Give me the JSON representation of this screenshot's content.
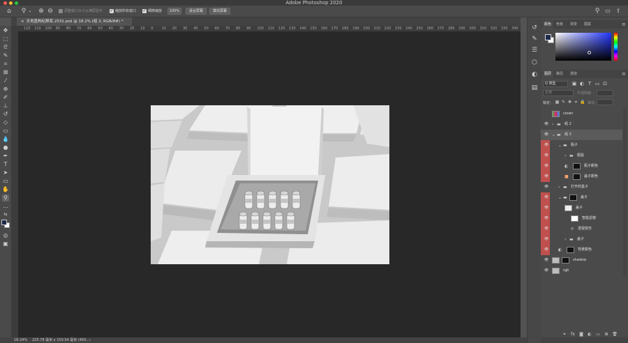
{
  "app": {
    "title": "Adobe Photoshop 2020",
    "traffic_colors": [
      "#ff5f57",
      "#febc2e",
      "#28c840"
    ]
  },
  "options_bar": {
    "resize_windows_label": "调整窗口大小以满屏显示",
    "zoom_all_windows_label": "缩放所有窗口",
    "scrubby_zoom_label": "细微缩放",
    "zoom_value": "100%",
    "fit_screen_label": "适合屏幕",
    "fill_screen_label": "填充屏幕"
  },
  "document": {
    "tab_title": "天地盖构纪屏浆.2531.psd @ 18.2% (组 3, RGB/8#) *",
    "close_glyph": "×"
  },
  "ruler": {
    "h_ticks": [
      "120",
      "110",
      "100",
      "90",
      "80",
      "70",
      "60",
      "50",
      "40",
      "30",
      "20",
      "10",
      "0",
      "10",
      "20",
      "30",
      "40",
      "50",
      "60",
      "70",
      "80",
      "90",
      "100",
      "110",
      "120",
      "130",
      "140",
      "150",
      "160",
      "170",
      "180",
      "190",
      "200",
      "210",
      "220",
      "230",
      "240",
      "250",
      "260",
      "270",
      "280",
      "290",
      "300",
      "310",
      "320",
      "330",
      "340"
    ]
  },
  "status": {
    "zoom": "18.24%",
    "doc_info": "225.78 毫米 x 150.54 毫米 (450...",
    "arrow": "›"
  },
  "panels": {
    "color_tabs": [
      "颜色",
      "色板",
      "渐变",
      "图案"
    ],
    "layer_tabs": [
      "图层",
      "路径",
      "通道"
    ],
    "filter_kind": "Q 类型",
    "blend_mode": "正常",
    "opacity_label": "不透明度:",
    "opacity_value": "",
    "lock_label": "锁定:",
    "fill_label": "填充:",
    "fill_value": "",
    "foreground_color": "#1e2a4a",
    "background_color": "#ffffff"
  },
  "layers": [
    {
      "name": "clown",
      "indent": 0,
      "visible": false,
      "red": false,
      "kind": "image"
    },
    {
      "name": "组 2",
      "indent": 0,
      "visible": true,
      "red": false,
      "kind": "group"
    },
    {
      "name": "组 3",
      "indent": 0,
      "visible": true,
      "red": false,
      "kind": "group",
      "selected": true
    },
    {
      "name": "瓶子",
      "indent": 1,
      "visible": true,
      "red": true,
      "kind": "group"
    },
    {
      "name": "瓶贴",
      "indent": 2,
      "visible": true,
      "red": true,
      "kind": "group"
    },
    {
      "name": "瓶子颜色",
      "indent": 2,
      "visible": true,
      "red": true,
      "kind": "adjust"
    },
    {
      "name": "盖子颜色",
      "indent": 2,
      "visible": true,
      "red": true,
      "kind": "fill"
    },
    {
      "name": "打开的盒子",
      "indent": 1,
      "visible": true,
      "red": false,
      "kind": "group"
    },
    {
      "name": "盖子",
      "indent": 1,
      "visible": true,
      "red": true,
      "kind": "group-mask"
    },
    {
      "name": "盖子",
      "indent": 2,
      "visible": true,
      "red": true,
      "kind": "smart"
    },
    {
      "name": "智能滤镜",
      "indent": 3,
      "visible": true,
      "red": true,
      "kind": "filter"
    },
    {
      "name": "透视变形",
      "indent": 3,
      "visible": true,
      "red": true,
      "kind": "effect"
    },
    {
      "name": "盖子",
      "indent": 2,
      "visible": true,
      "red": true,
      "kind": "group"
    },
    {
      "name": "背景颜色",
      "indent": 1,
      "visible": true,
      "red": true,
      "kind": "adjust"
    },
    {
      "name": "shadow",
      "indent": 0,
      "visible": true,
      "red": false,
      "kind": "image"
    },
    {
      "name": "rgb",
      "indent": 0,
      "visible": true,
      "red": false,
      "kind": "image"
    }
  ]
}
